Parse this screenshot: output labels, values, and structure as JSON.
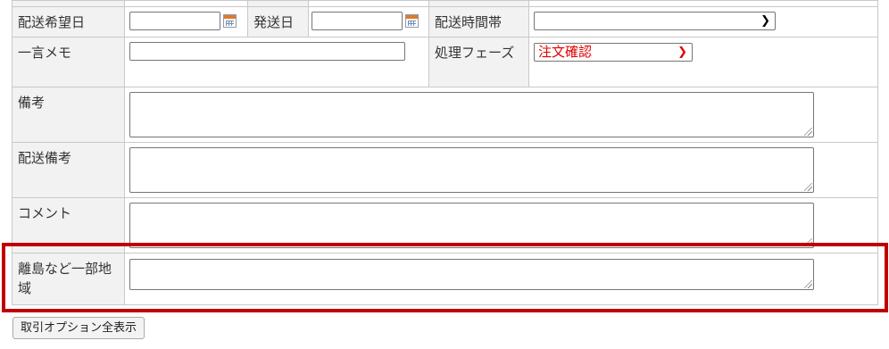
{
  "form": {
    "delivery_date_label": "配送希望日",
    "ship_date_label": "発送日",
    "delivery_time_label": "配送時間帯",
    "delivery_time_value": "",
    "memo_label": "一言メモ",
    "phase_label": "処理フェーズ",
    "phase_value": "注文確認",
    "remarks_label": "備考",
    "delivery_remarks_label": "配送備考",
    "comment_label": "コメント",
    "remote_area_label": "離島など一部地域"
  },
  "buttons": {
    "show_all_options": "取引オプション全表示"
  },
  "icons": {
    "calendar": "calendar-icon",
    "dropdown": "chevron-down-icon",
    "resize": "resize-grip-icon"
  },
  "colors": {
    "highlight_border": "#c00000",
    "phase_text": "#e00000",
    "label_background": "#f2f2f2",
    "calendar_accent": "#e07b2a"
  }
}
